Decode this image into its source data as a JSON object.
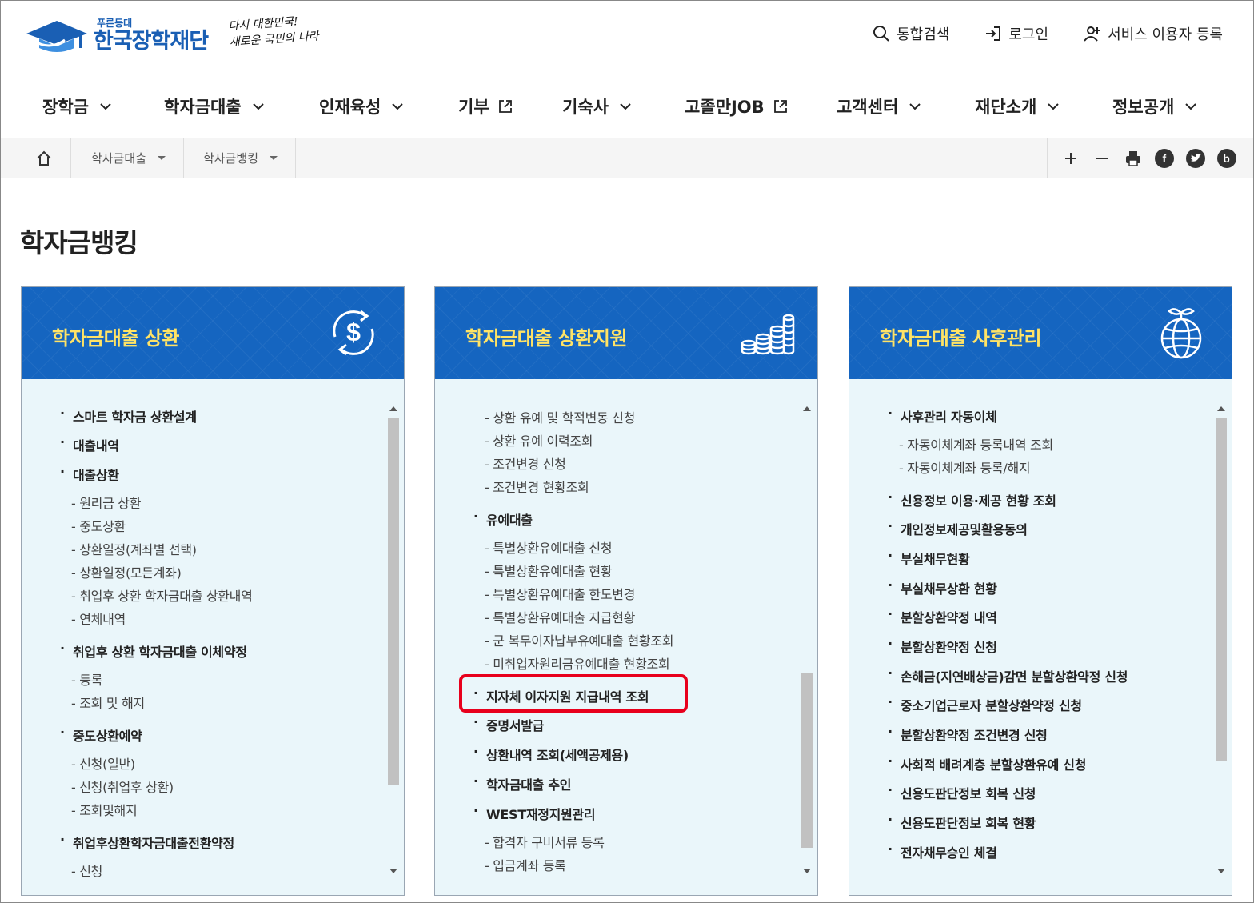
{
  "header": {
    "logo_small": "푸른등대",
    "logo_main": "한국장학재단",
    "slogan_line1": "다시 대한민국!",
    "slogan_line2": "새로운 국민의 나라",
    "links": [
      {
        "label": "통합검색",
        "icon": "search-icon"
      },
      {
        "label": "로그인",
        "icon": "login-icon"
      },
      {
        "label": "서비스 이용자 등록",
        "icon": "user-add-icon"
      }
    ]
  },
  "gnb": [
    {
      "label": "장학금",
      "icon": "chevron-down-icon"
    },
    {
      "label": "학자금대출",
      "icon": "chevron-down-icon"
    },
    {
      "label": "인재육성",
      "icon": "chevron-down-icon"
    },
    {
      "label": "기부",
      "icon": "external-link-icon"
    },
    {
      "label": "기숙사",
      "icon": "chevron-down-icon"
    },
    {
      "label": "고졸만JOB",
      "icon": "external-link-icon"
    },
    {
      "label": "고객센터",
      "icon": "chevron-down-icon"
    },
    {
      "label": "재단소개",
      "icon": "chevron-down-icon"
    },
    {
      "label": "정보공개",
      "icon": "chevron-down-icon"
    }
  ],
  "breadcrumb": [
    "학자금대출",
    "학자금뱅킹"
  ],
  "tools": [
    "plus-icon",
    "minus-icon",
    "print-icon",
    "facebook-icon",
    "twitter-icon",
    "blog-icon"
  ],
  "page_title": "학자금뱅킹",
  "panels": [
    {
      "title": "학자금대출 상환",
      "icon": "dollar-cycle-icon",
      "items": [
        {
          "type": "main",
          "label": "스마트 학자금 상환설계"
        },
        {
          "type": "main",
          "label": "대출내역"
        },
        {
          "type": "main",
          "label": "대출상환"
        },
        {
          "type": "sub",
          "label": "원리금 상환"
        },
        {
          "type": "sub",
          "label": "중도상환"
        },
        {
          "type": "sub",
          "label": "상환일정(계좌별 선택)"
        },
        {
          "type": "sub",
          "label": "상환일정(모든계좌)"
        },
        {
          "type": "sub",
          "label": "취업후 상환 학자금대출 상환내역"
        },
        {
          "type": "sub",
          "label": "연체내역"
        },
        {
          "type": "main",
          "label": "취업후 상환 학자금대출 이체약정"
        },
        {
          "type": "sub",
          "label": "등록"
        },
        {
          "type": "sub",
          "label": "조회 및 해지"
        },
        {
          "type": "main",
          "label": "중도상환예약"
        },
        {
          "type": "sub",
          "label": "신청(일반)"
        },
        {
          "type": "sub",
          "label": "신청(취업후 상환)"
        },
        {
          "type": "sub",
          "label": "조회및해지"
        },
        {
          "type": "main",
          "label": "취업후상환학자금대출전환약정"
        },
        {
          "type": "sub",
          "label": "신청"
        }
      ]
    },
    {
      "title": "학자금대출 상환지원",
      "icon": "coins-stack-icon",
      "items": [
        {
          "type": "sub",
          "label": "상환 유예 및 학적변동 신청"
        },
        {
          "type": "sub",
          "label": "상환 유예 이력조회"
        },
        {
          "type": "sub",
          "label": "조건변경 신청"
        },
        {
          "type": "sub",
          "label": "조건변경 현황조회"
        },
        {
          "type": "main",
          "label": "유예대출"
        },
        {
          "type": "sub",
          "label": "특별상환유예대출 신청"
        },
        {
          "type": "sub",
          "label": "특별상환유예대출 현황"
        },
        {
          "type": "sub",
          "label": "특별상환유예대출 한도변경"
        },
        {
          "type": "sub",
          "label": "특별상환유예대출 지급현황"
        },
        {
          "type": "sub",
          "label": "군 복무이자납부유예대출 현황조회"
        },
        {
          "type": "sub",
          "label": "미취업자원리금유예대출 현황조회"
        },
        {
          "type": "main",
          "label": "지자체 이자지원 지급내역 조회"
        },
        {
          "type": "main",
          "label": "증명서발급"
        },
        {
          "type": "main",
          "label": "상환내역 조회(세액공제용)"
        },
        {
          "type": "main",
          "label": "학자금대출 추인"
        },
        {
          "type": "main",
          "label": "WEST재정지원관리"
        },
        {
          "type": "sub",
          "label": "합격자 구비서류 등록"
        },
        {
          "type": "sub",
          "label": "입금계좌 등록"
        }
      ]
    },
    {
      "title": "학자금대출 사후관리",
      "icon": "globe-sprout-icon",
      "items": [
        {
          "type": "main",
          "label": "사후관리 자동이체"
        },
        {
          "type": "sub",
          "label": "자동이체계좌 등록내역 조회"
        },
        {
          "type": "sub",
          "label": "자동이체계좌 등록/해지"
        },
        {
          "type": "main",
          "label": "신용정보 이용·제공 현황 조회"
        },
        {
          "type": "main",
          "label": "개인정보제공및활용동의"
        },
        {
          "type": "main",
          "label": "부실채무현황"
        },
        {
          "type": "main",
          "label": "부실채무상환 현황"
        },
        {
          "type": "main",
          "label": "분할상환약정 내역"
        },
        {
          "type": "main",
          "label": "분할상환약정 신청"
        },
        {
          "type": "main",
          "label": "손해금(지연배상금)감면 분할상환약정 신청"
        },
        {
          "type": "main",
          "label": "중소기업근로자 분할상환약정 신청"
        },
        {
          "type": "main",
          "label": "분할상환약정 조건변경 신청"
        },
        {
          "type": "main",
          "label": "사회적 배려계층 분할상환유예 신청"
        },
        {
          "type": "main",
          "label": "신용도판단정보 회복 신청"
        },
        {
          "type": "main",
          "label": "신용도판단정보 회복 현황"
        },
        {
          "type": "main",
          "label": "전자채무승인 체결"
        }
      ]
    }
  ],
  "colors": {
    "brand_blue": "#1565c0",
    "panel_title": "#ffe366",
    "panel_bg": "#eaf6fa",
    "highlight": "#e8001c"
  }
}
